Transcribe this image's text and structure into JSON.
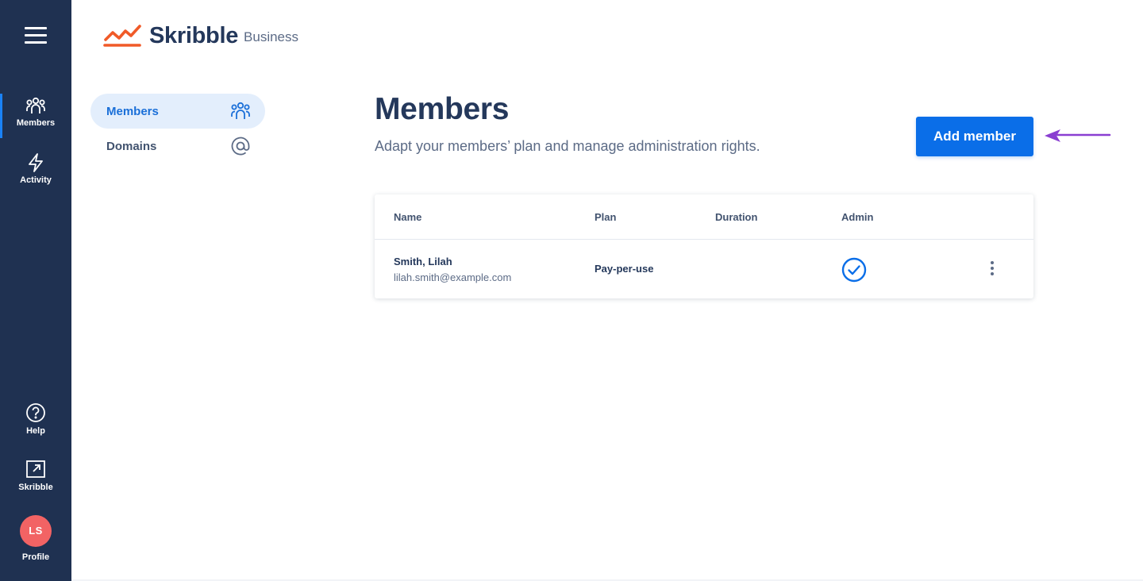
{
  "app": {
    "brand": "Skribble",
    "tier": "Business"
  },
  "rail": {
    "items": [
      {
        "label": "Members",
        "icon": "members-icon",
        "active": true
      },
      {
        "label": "Activity",
        "icon": "lightning-icon",
        "active": false
      }
    ],
    "bottom_items": [
      {
        "label": "Help",
        "icon": "help-icon"
      },
      {
        "label": "Skribble",
        "icon": "external-link-icon"
      }
    ],
    "profile": {
      "initials": "LS",
      "label": "Profile"
    }
  },
  "subnav": {
    "items": [
      {
        "label": "Members",
        "icon": "members-icon",
        "active": true
      },
      {
        "label": "Domains",
        "icon": "at-icon",
        "active": false
      }
    ]
  },
  "main": {
    "title": "Members",
    "subtitle": "Adapt your members’ plan and manage administration rights.",
    "add_button": "Add member"
  },
  "table": {
    "columns": [
      "Name",
      "Plan",
      "Duration",
      "Admin"
    ],
    "rows": [
      {
        "name": "Smith, Lilah",
        "email": "lilah.smith@example.com",
        "plan": "Pay-per-use",
        "duration": "",
        "admin": true
      }
    ]
  },
  "colors": {
    "rail_bg": "#1f3151",
    "primary": "#0a6ee8",
    "brand_orange": "#f05a28",
    "avatar": "#f26364",
    "annotation_arrow": "#8a3fd1"
  }
}
